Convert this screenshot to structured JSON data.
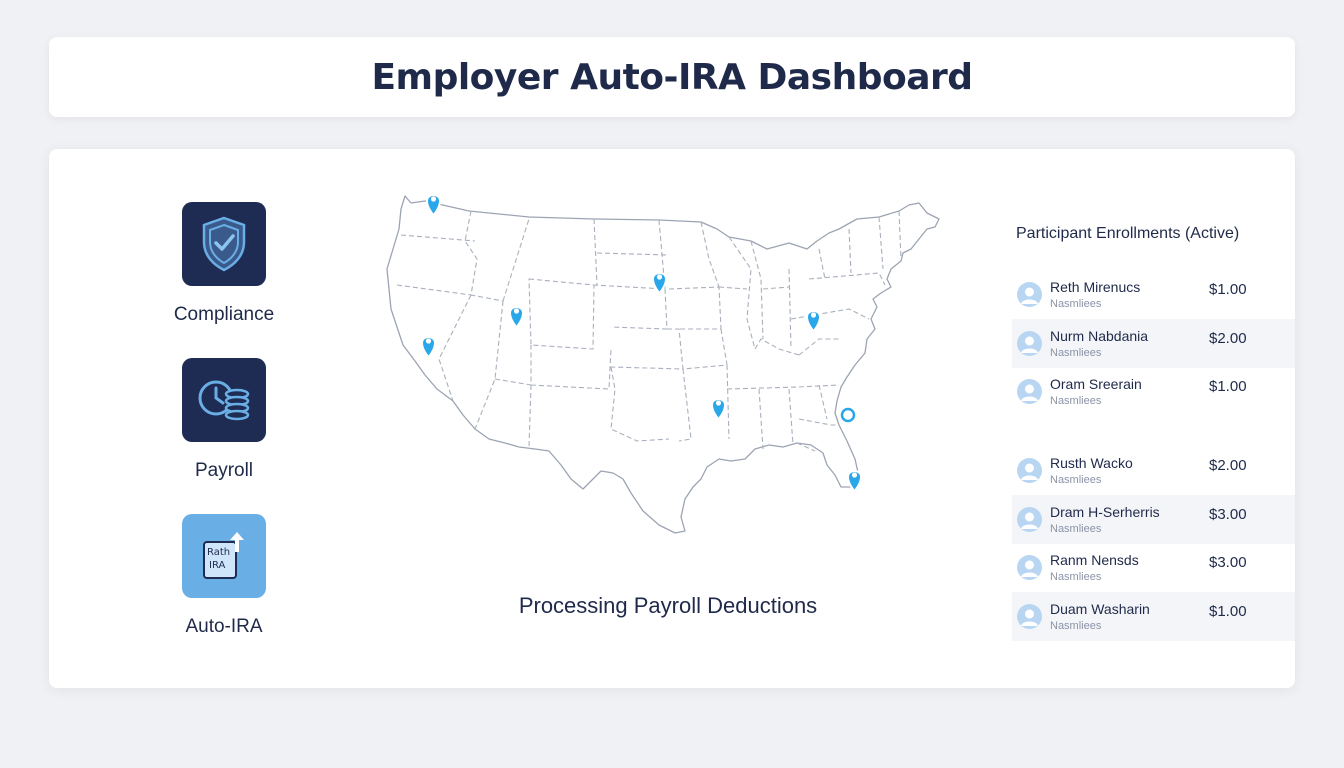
{
  "header": {
    "title": "Employer Auto-IRA Dashboard"
  },
  "nav": [
    {
      "label": "Compliance",
      "icon": "shield-check-icon"
    },
    {
      "label": "Payroll",
      "icon": "clock-coins-icon"
    },
    {
      "label": "Auto-IRA",
      "icon": "roth-ira-document-icon",
      "tile_text": [
        "Rath",
        "IRA"
      ]
    }
  ],
  "map": {
    "caption": "Processing Payroll Deductions",
    "pin_color": "#2aa7e8"
  },
  "enrollments": {
    "title": "Participant Enrollments (Active)",
    "rows": [
      {
        "name": "Reth Mirenucs",
        "sub": "Nasmliees",
        "amount": "$1.00"
      },
      {
        "name": "Nurm Nabdania",
        "sub": "Nasmliees",
        "amount": "$2.00"
      },
      {
        "name": "Oram Sreerain",
        "sub": "Nasmliees",
        "amount": "$1.00"
      },
      {
        "name": "Rusth Wacko",
        "sub": "Nasmliees",
        "amount": "$2.00"
      },
      {
        "name": "Dram H-Serherris",
        "sub": "Nasmliees",
        "amount": "$3.00"
      },
      {
        "name": "Ranm Nensds",
        "sub": "Nasmliees",
        "amount": "$3.00"
      },
      {
        "name": "Duam Washarin",
        "sub": "Nasmliees",
        "amount": "$1.00"
      }
    ]
  },
  "colors": {
    "navy": "#1e2b52",
    "accent": "#6aaee6",
    "text": "#1f2a4a"
  }
}
